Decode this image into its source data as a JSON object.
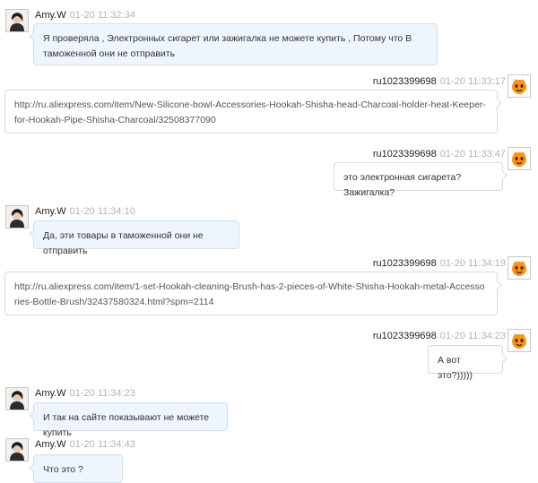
{
  "messages": [
    {
      "sender": "Amy.W",
      "time": "01-20 11:32:34",
      "text": "Я проверяла , Электронных сигарет  или зажигалка  не можете купить , Потому что В таможенной они не отправить",
      "direction": "in"
    },
    {
      "sender": "ru1023399698",
      "time": "01-20 11:33:17",
      "text": "http://ru.aliexpress.com/item/New-Silicone-bowl-Accessories-Hookah-Shisha-head-Charcoal-holder-heat-Keeper-for-Hookah-Pipe-Shisha-Charcoal/32508377090",
      "direction": "out"
    },
    {
      "sender": "ru1023399698",
      "time": "01-20 11:33:47",
      "text": "это электронная сигарета? Зажигалка?",
      "direction": "out"
    },
    {
      "sender": "Amy.W",
      "time": "01-20 11:34:10",
      "text": "Да, эти товары  в таможенной они не отправить",
      "direction": "in"
    },
    {
      "sender": "ru1023399698",
      "time": "01-20 11:34:19",
      "text": "http://ru.aliexpress.com/item/1-set-Hookah-cleaning-Brush-has-2-pieces-of-White-Shisha-Hookah-metal-Accessories-Bottle-Brush/32437580324.html?spm=2114",
      "direction": "out"
    },
    {
      "sender": "ru1023399698",
      "time": "01-20 11:34:23",
      "text": "А вот это?)))))",
      "direction": "out"
    },
    {
      "sender": "Amy.W",
      "time": "01-20 11:34:23",
      "text": "И так на сайте показывают не можете купить",
      "direction": "in"
    },
    {
      "sender": "Amy.W",
      "time": "01-20 11:34:43",
      "text": "Что это ?",
      "direction": "in"
    }
  ],
  "icons": {
    "agent_avatar": "user-photo-avatar",
    "buyer_avatar": "orange-mascot-avatar"
  },
  "colors": {
    "in_bubble": "#eef5fc",
    "out_bubble": "#ffffff",
    "timestamp": "#b3b3b3",
    "mascot": "#f7941d"
  }
}
